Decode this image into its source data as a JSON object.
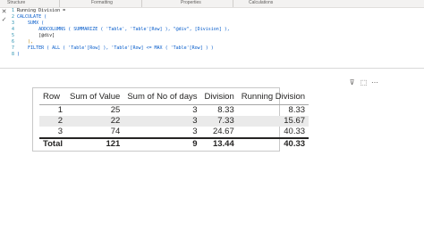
{
  "ribbon": {
    "tabs": [
      "Structure",
      "Formatting",
      "Properties",
      "Calculations"
    ]
  },
  "editor": {
    "lines": [
      {
        "num": "1",
        "text": "Running Division ="
      },
      {
        "num": "2",
        "text": "CALCULATE ("
      },
      {
        "num": "3",
        "text": "    SUMX ("
      },
      {
        "num": "4",
        "text": "        ADDCOLUMNS ( SUMMARIZE ( 'Table', 'Table'[Row] ), \"@div\", [Division] ),"
      },
      {
        "num": "5",
        "text": "        [@div]"
      },
      {
        "num": "6",
        "text": "    ),"
      },
      {
        "num": "7",
        "text": "    FILTER ( ALL ( 'Table'[Row] ), 'Table'[Row] <= MAX ( 'Table'[Row] ) )"
      },
      {
        "num": "8",
        "text": ")"
      }
    ],
    "cancel_icon": "close-icon",
    "commit_icon": "checkmark-icon"
  },
  "visual_header": {
    "filter_icon": "filter-icon",
    "focus_icon": "focus-mode-icon",
    "more_icon": "more-options-icon",
    "filter_glyph": "⊽",
    "focus_glyph": "⬚",
    "more_glyph": "⋯"
  },
  "table": {
    "columns": [
      "Row",
      "Sum of Value",
      "Sum of No of days",
      "Division",
      "Running Division"
    ],
    "rows": [
      [
        "1",
        "25",
        "3",
        "8.33",
        "8.33"
      ],
      [
        "2",
        "22",
        "3",
        "7.33",
        "15.67"
      ],
      [
        "3",
        "74",
        "3",
        "24.67",
        "40.33"
      ]
    ],
    "total": [
      "Total",
      "121",
      "9",
      "13.44",
      "40.33"
    ]
  }
}
